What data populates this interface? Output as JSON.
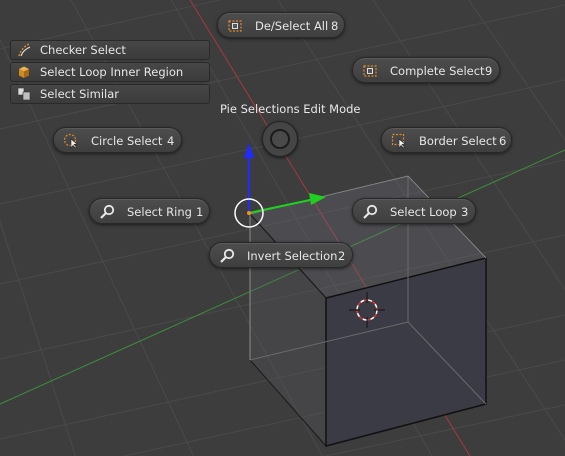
{
  "app": "Blender 3D Viewport",
  "pie_menu": {
    "title": "Pie Selections Edit Mode",
    "items": {
      "deselect_all": {
        "label": "De/Select All",
        "number": "8",
        "icon": "select-all-icon"
      },
      "complete_select": {
        "label": "Complete Select",
        "number": "9",
        "icon": "complete-select-icon"
      },
      "circle_select": {
        "label": "Circle Select",
        "number": "4",
        "icon": "circle-select-icon"
      },
      "border_select": {
        "label": "Border Select",
        "number": "6",
        "icon": "border-select-icon"
      },
      "select_ring": {
        "label": "Select Ring",
        "number": "1",
        "icon": "ring-select-icon"
      },
      "select_loop": {
        "label": "Select Loop",
        "number": "3",
        "icon": "loop-select-icon"
      },
      "invert_selection": {
        "label": "Invert Selection",
        "number": "2",
        "icon": "invert-selection-icon"
      }
    }
  },
  "extra_menu": {
    "items": [
      {
        "label": "Checker Select",
        "icon": "checker-select-icon"
      },
      {
        "label": "Select Loop Inner Region",
        "icon": "loop-inner-region-icon"
      },
      {
        "label": "Select Similar",
        "icon": "select-similar-icon"
      }
    ]
  },
  "colors": {
    "background": "#3d3d3d",
    "grid": "#4a4a4a",
    "x_axis": "#a33a3a",
    "y_axis": "#3d8f3d",
    "gizmo_z": "#1f2bff",
    "gizmo_y": "#20d020",
    "cube_dark_face": "#3a3b45",
    "pill": "#474747",
    "text": "#e6e6e6"
  }
}
